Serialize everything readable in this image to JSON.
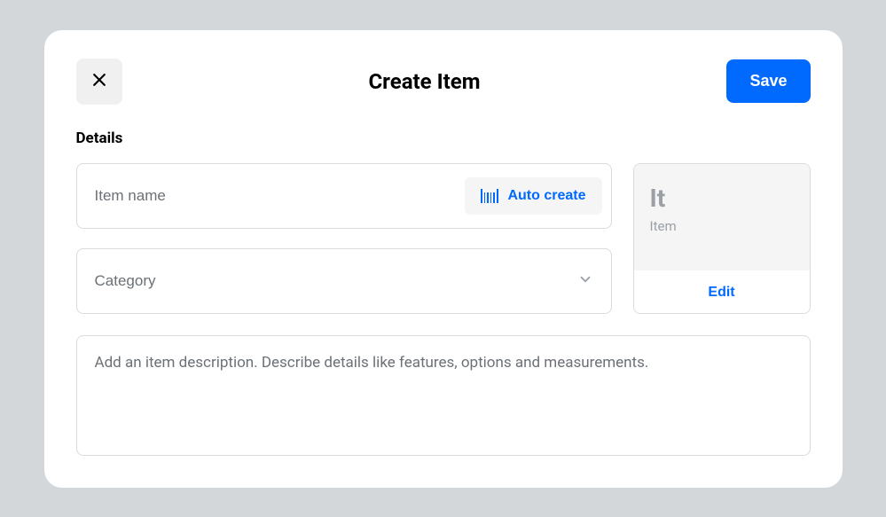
{
  "header": {
    "title": "Create Item",
    "save_label": "Save"
  },
  "details": {
    "heading": "Details",
    "item_name": {
      "value": "",
      "placeholder": "Item name"
    },
    "auto_create_label": "Auto create",
    "category": {
      "placeholder": "Category",
      "value": ""
    },
    "description": {
      "value": "",
      "placeholder": "Add an item description. Describe details like features, options and measurements."
    }
  },
  "preview": {
    "abbrev": "It",
    "type_label": "Item",
    "edit_label": "Edit"
  }
}
